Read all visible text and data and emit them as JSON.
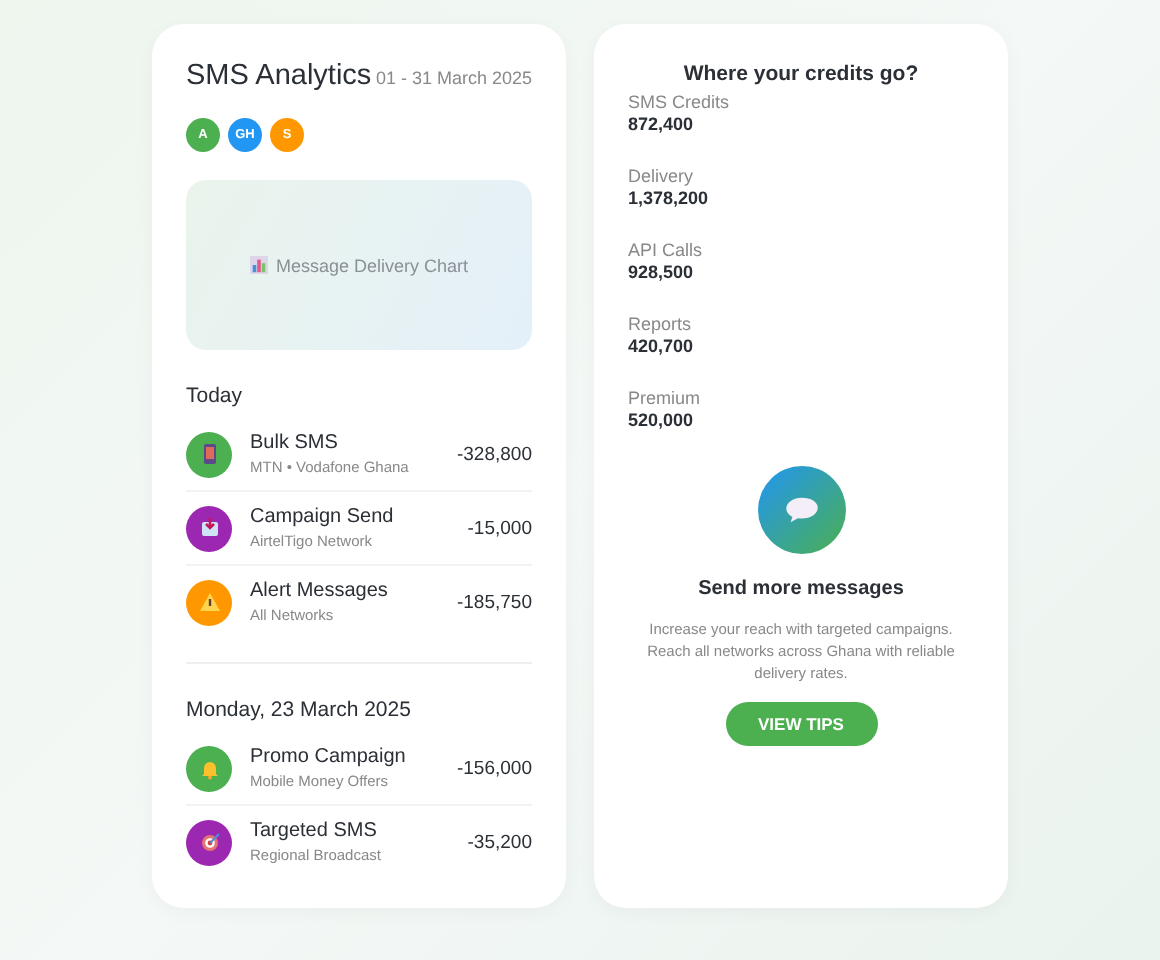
{
  "analytics": {
    "title": "SMS Analytics",
    "date_range": "01 - 31 March 2025",
    "avatars": [
      {
        "label": "A",
        "color": "#4caf50"
      },
      {
        "label": "GH",
        "color": "#2196f3"
      },
      {
        "label": "S",
        "color": "#ff9800"
      }
    ],
    "chart_placeholder": "Message Delivery Chart",
    "groups": [
      {
        "heading": "Today",
        "items": [
          {
            "kind": "phone",
            "color": "#4caf50",
            "title": "Bulk SMS",
            "subtitle": "MTN • Vodafone Ghana",
            "amount": "-328,800"
          },
          {
            "kind": "inbox",
            "color": "#9c27b0",
            "title": "Campaign Send",
            "subtitle": "AirtelTigo Network",
            "amount": "-15,000"
          },
          {
            "kind": "warning",
            "color": "#ff9800",
            "title": "Alert Messages",
            "subtitle": "All Networks",
            "amount": "-185,750"
          }
        ]
      },
      {
        "heading": "Monday, 23 March 2025",
        "items": [
          {
            "kind": "bell",
            "color": "#4caf50",
            "title": "Promo Campaign",
            "subtitle": "Mobile Money Offers",
            "amount": "-156,000"
          },
          {
            "kind": "target",
            "color": "#9c27b0",
            "title": "Targeted SMS",
            "subtitle": "Regional Broadcast",
            "amount": "-35,200"
          }
        ]
      }
    ]
  },
  "credits": {
    "title": "Where your credits go?",
    "stats": [
      {
        "label": "SMS Credits",
        "value": "872,400"
      },
      {
        "label": "Delivery",
        "value": "1,378,200"
      },
      {
        "label": "API Calls",
        "value": "928,500"
      },
      {
        "label": "Reports",
        "value": "420,700"
      },
      {
        "label": "Premium",
        "value": "520,000"
      }
    ],
    "promo": {
      "title": "Send more messages",
      "text": "Increase your reach with targeted campaigns. Reach all networks across Ghana with reliable delivery rates.",
      "button": "VIEW TIPS"
    }
  }
}
